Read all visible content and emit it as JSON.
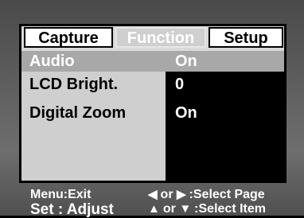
{
  "tabs": [
    {
      "label": "Capture"
    },
    {
      "label": "Function"
    },
    {
      "label": "Setup"
    }
  ],
  "menu": [
    {
      "label": "Audio",
      "value": "On"
    },
    {
      "label": "LCD Bright.",
      "value": "0"
    },
    {
      "label": "Digital Zoom",
      "value": "On"
    }
  ],
  "footer": {
    "menu_exit": "Menu:Exit",
    "set_adjust": "Set : Adjust",
    "left_arrow": "◀",
    "page_or": "or",
    "right_arrow": "▶",
    "select_page": ":Select Page",
    "up_arrow": "▲",
    "item_or": "or",
    "down_arrow": "▼",
    "select_item": ":Select Item"
  },
  "colors": {
    "active_tab_bg": "#cfcfcf",
    "selected_row_bg": "#a8a8a8",
    "value_panel_bg": "#000000"
  }
}
